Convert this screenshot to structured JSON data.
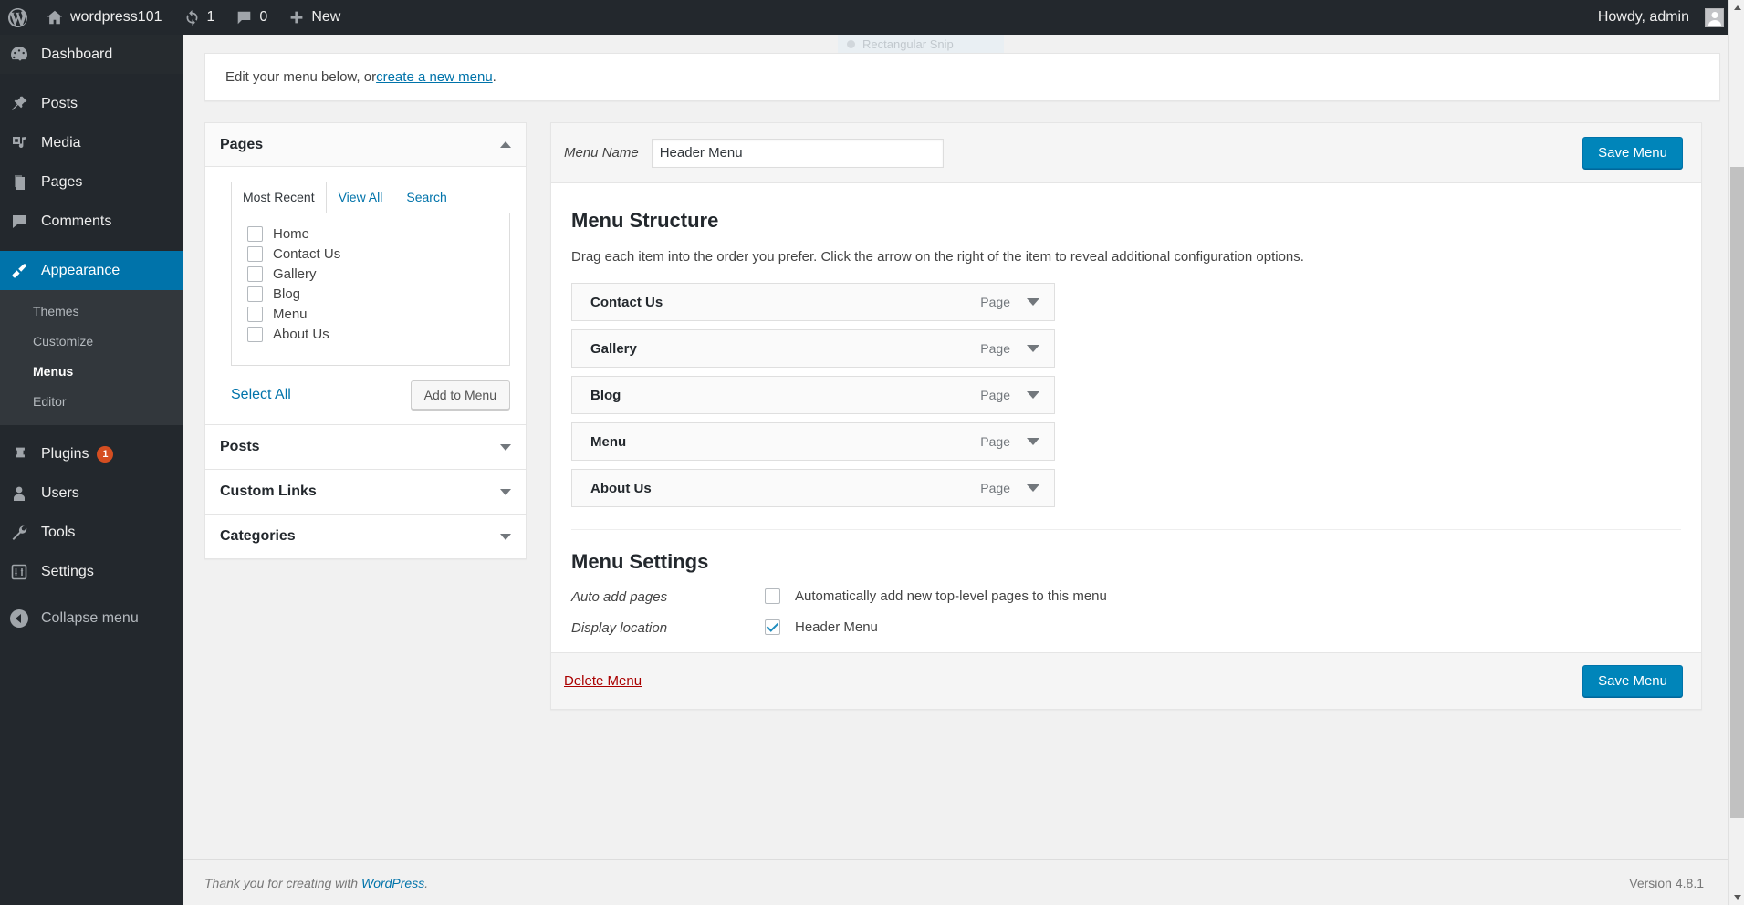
{
  "adminbar": {
    "site_name": "wordpress101",
    "updates_count": "1",
    "comments_count": "0",
    "new_label": "New",
    "howdy": "Howdy, admin"
  },
  "sidebar": {
    "items": [
      {
        "label": "Dashboard",
        "icon": "dashboard-icon"
      },
      {
        "label": "Posts",
        "icon": "pin-icon"
      },
      {
        "label": "Media",
        "icon": "media-icon"
      },
      {
        "label": "Pages",
        "icon": "pages-icon"
      },
      {
        "label": "Comments",
        "icon": "comment-icon"
      },
      {
        "label": "Appearance",
        "icon": "brush-icon"
      },
      {
        "label": "Plugins",
        "icon": "plug-icon",
        "badge": "1"
      },
      {
        "label": "Users",
        "icon": "user-icon"
      },
      {
        "label": "Tools",
        "icon": "wrench-icon"
      },
      {
        "label": "Settings",
        "icon": "sliders-icon"
      },
      {
        "label": "Collapse menu",
        "icon": "collapse-icon"
      }
    ],
    "appearance_submenu": [
      {
        "label": "Themes",
        "current": false
      },
      {
        "label": "Customize",
        "current": false
      },
      {
        "label": "Menus",
        "current": true
      },
      {
        "label": "Editor",
        "current": false
      }
    ]
  },
  "overlay": {
    "snip_label": "Rectangular Snip"
  },
  "notice": {
    "text_before": "Edit your menu below, or ",
    "link": "create a new menu",
    "text_after": "."
  },
  "accordion": {
    "pages": {
      "title": "Pages",
      "caret": "caret-up-icon",
      "tabs": [
        {
          "label": "Most Recent",
          "active": true
        },
        {
          "label": "View All",
          "active": false
        },
        {
          "label": "Search",
          "active": false
        }
      ],
      "checkboxes": [
        {
          "label": "Home",
          "checked": false
        },
        {
          "label": "Contact Us",
          "checked": false
        },
        {
          "label": "Gallery",
          "checked": false
        },
        {
          "label": "Blog",
          "checked": false
        },
        {
          "label": "Menu",
          "checked": false
        },
        {
          "label": "About Us",
          "checked": false
        }
      ],
      "select_all": "Select All",
      "add_to_menu": "Add to Menu"
    },
    "collapsed": [
      {
        "title": "Posts",
        "caret": "caret-down-icon"
      },
      {
        "title": "Custom Links",
        "caret": "caret-down-icon"
      },
      {
        "title": "Categories",
        "caret": "caret-down-icon"
      }
    ]
  },
  "editor": {
    "menu_name_label": "Menu Name",
    "menu_name_value": "Header Menu",
    "menu_name_placeholder": "Menu Name",
    "save_top": "Save Menu",
    "structure_title": "Menu Structure",
    "structure_hint": "Drag each item into the order you prefer. Click the arrow on the right of the item to reveal additional configuration options.",
    "menu_items": [
      {
        "title": "Contact Us",
        "type": "Page"
      },
      {
        "title": "Gallery",
        "type": "Page"
      },
      {
        "title": "Blog",
        "type": "Page"
      },
      {
        "title": "Menu",
        "type": "Page"
      },
      {
        "title": "About Us",
        "type": "Page"
      }
    ],
    "settings_title": "Menu Settings",
    "auto_add_label": "Auto add pages",
    "auto_add_checkbox_label": "Automatically add new top-level pages to this menu",
    "auto_add_checked": false,
    "display_location_label": "Display location",
    "display_location_checkbox_label": "Header Menu",
    "display_location_checked": true,
    "delete_menu": "Delete Menu",
    "save_bottom": "Save Menu"
  },
  "footer": {
    "thanks_before": "Thank you for creating with ",
    "thanks_link": "WordPress",
    "thanks_after": ".",
    "version": "Version 4.8.1"
  },
  "colors": {
    "admin_bar": "#23282d",
    "sidebar": "#23282d",
    "accent_blue": "#0073aa",
    "button_blue": "#0085ba",
    "badge_orange": "#d54e21",
    "delete_red": "#a00"
  }
}
